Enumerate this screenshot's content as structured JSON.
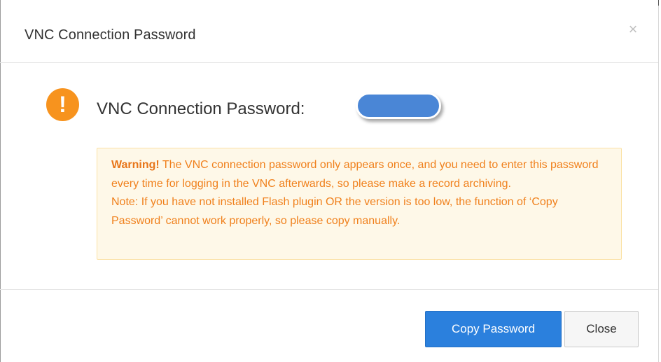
{
  "dialog": {
    "title": "VNC Connection Password",
    "close_icon": "close-icon",
    "close_glyph": "×"
  },
  "body": {
    "alert_icon": "exclamation-icon",
    "alert_glyph": "!",
    "password_label": "VNC Connection Password:",
    "password_value": "",
    "password_redacted": true
  },
  "warning": {
    "heading": "Warning!",
    "message": " The VNC connection password only appears once, and you need to enter this password every time for logging in the VNC afterwards, so please make a record archiving.",
    "note": "Note: If you have not installed Flash plugin OR the version is too low, the function of ‘Copy Password’ cannot work properly, so please copy manually."
  },
  "footer": {
    "copy_label": "Copy Password",
    "close_label": "Close"
  },
  "colors": {
    "alert_icon": "#f7931e",
    "warning_text": "#f0801c",
    "warning_background": "#fef8e8",
    "warning_border": "#fbe1a4",
    "primary_button": "#2b80dd",
    "password_redaction": "#4a86d6"
  }
}
